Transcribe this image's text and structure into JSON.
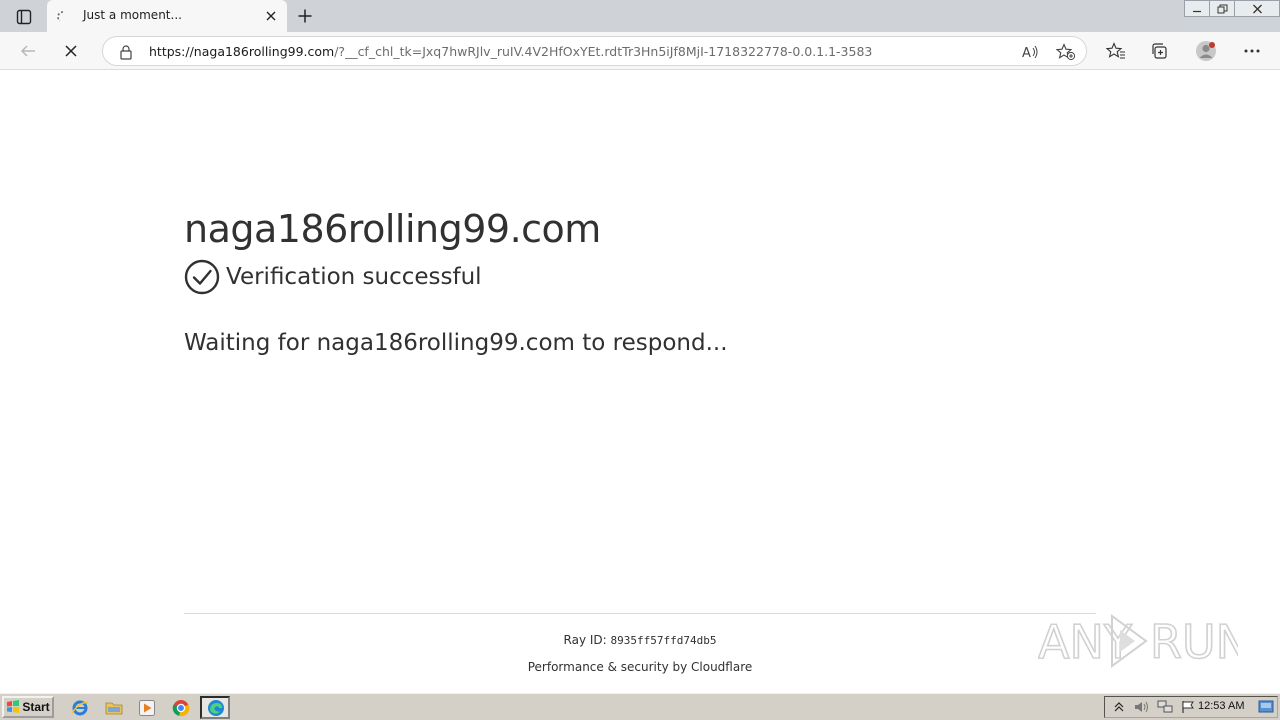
{
  "browser": {
    "tab_title": "Just a moment...",
    "url_host": "https://naga186rolling99.com",
    "url_rest": "/?__cf_chl_tk=Jxq7hwRJlv_ruIV.4V2HfOxYEt.rdtTr3Hn5iJf8MjI-1718322778-0.0.1.1-3583",
    "icons": [
      "tab-actions-icon",
      "tab-loading-icon",
      "close-icon",
      "plus-icon",
      "back-arrow-icon",
      "stop-icon",
      "lock-icon",
      "read-aloud-icon",
      "add-favorite-icon",
      "favorites-icon",
      "collections-icon",
      "profile-icon",
      "more-icon"
    ]
  },
  "page": {
    "site_heading": "naga186rolling99.com",
    "verify_text": "Verification successful",
    "waiting_text": "Waiting for naga186rolling99.com to respond...",
    "ray_label": "Ray ID: ",
    "ray_value": "8935ff57ffd74db5",
    "performance_text": "Performance & security by Cloudflare",
    "watermark_text": "ANY RUN"
  },
  "taskbar": {
    "start_label": "Start",
    "clock": "12:53 AM",
    "icons": [
      "internet-explorer-icon",
      "folder-icon",
      "media-player-icon",
      "chrome-icon",
      "edge-icon"
    ],
    "tray_icons": [
      "tray-expand-icon",
      "volume-icon",
      "network-icon",
      "flag-icon"
    ]
  },
  "colors": {
    "tabstrip": "#cfd3d8",
    "toolbar": "#f7f7f7",
    "page_text": "#313131",
    "taskbar": "#d4d0c8"
  }
}
